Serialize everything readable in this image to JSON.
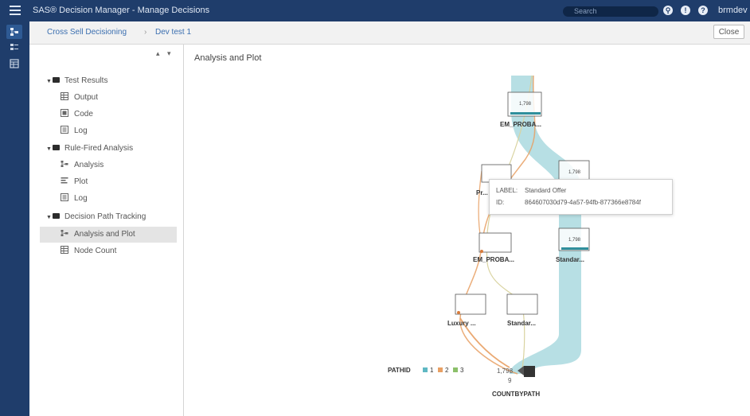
{
  "app": {
    "title": "SAS® Decision Manager - Manage Decisions"
  },
  "header": {
    "search_placeholder": "Search",
    "user": "brmdev",
    "icons": [
      "search-icon",
      "alert-icon",
      "help-icon"
    ]
  },
  "breadcrumb": {
    "items": [
      "Cross Sell Decisioning",
      "Dev test 1"
    ],
    "separator": "›"
  },
  "close_label": "Close",
  "tree": {
    "groups": [
      {
        "label": "Test Results",
        "children": [
          "Output",
          "Code",
          "Log"
        ]
      },
      {
        "label": "Rule-Fired Analysis",
        "children": [
          "Analysis",
          "Plot",
          "Log"
        ]
      },
      {
        "label": "Decision Path Tracking",
        "children": [
          "Analysis and Plot",
          "Node Count"
        ]
      }
    ],
    "selected": "Analysis and Plot"
  },
  "main": {
    "title": "Analysis and Plot"
  },
  "plot": {
    "nodes": [
      {
        "name": "EM_PROBA...",
        "value": "1,798"
      },
      {
        "name": "Pr...",
        "value": ""
      },
      {
        "name": "",
        "value": "1,798"
      },
      {
        "name": "EM_PROBA...",
        "value": ""
      },
      {
        "name": "Standar...",
        "value": "1,798"
      },
      {
        "name": "Luxury ...",
        "value": ""
      },
      {
        "name": "Standar...",
        "value": ""
      },
      {
        "name": "COUNTBYPATH",
        "value": ""
      }
    ],
    "end_counts": [
      "1,798",
      "9"
    ],
    "tooltip": {
      "label_key": "LABEL:",
      "label_value": "Standard Offer",
      "id_key": "ID:",
      "id_value": "864607030d79-4a57-94fb-877366e8784f"
    },
    "legend": {
      "title": "PATHID",
      "items": [
        {
          "label": "1",
          "color": "#5fb8c3"
        },
        {
          "label": "2",
          "color": "#e8a064"
        },
        {
          "label": "3",
          "color": "#8cc06a"
        }
      ]
    }
  },
  "colors": {
    "accent": "#1f3d6b",
    "path1": "#5fb8c3",
    "path2": "#e8a064",
    "path3": "#b6c98a"
  }
}
